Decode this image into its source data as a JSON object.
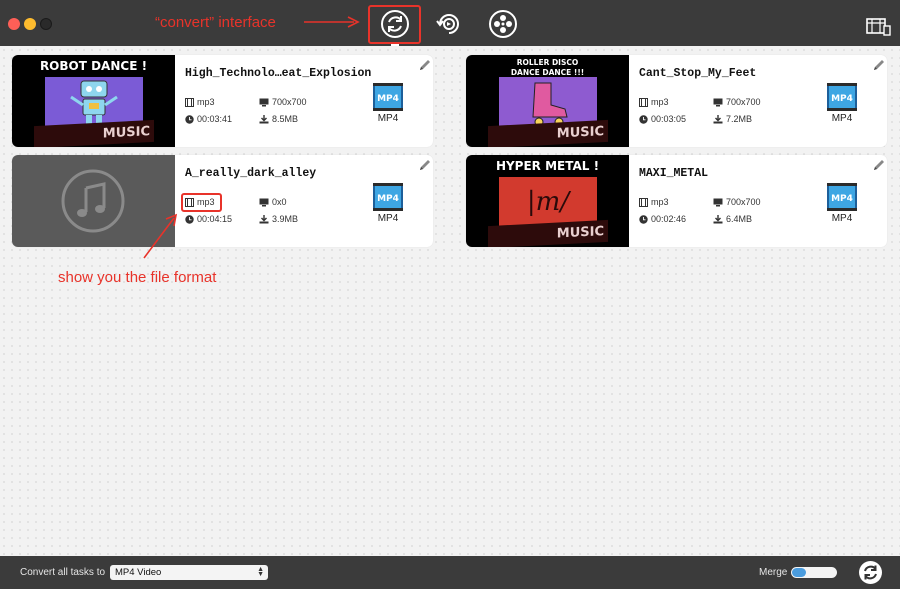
{
  "toolbar": {
    "active_tool": "convert",
    "tools": [
      "convert-icon",
      "rotate-convert-icon",
      "film-reel-icon"
    ],
    "settings_icon": "video-settings-icon"
  },
  "annotations": {
    "convert_note": "“convert” interface",
    "format_note": "show you the file format",
    "color": "#e8332a"
  },
  "tasks": [
    {
      "name": "High_Technolo…eat_Explosion",
      "thumb_title": "ROBOT DANCE !",
      "thumb_footer": "MUSIC",
      "format": "mp3",
      "resolution": "700x700",
      "duration": "00:03:41",
      "size": "8.5MB",
      "target": "MP4",
      "thumb_bg": "#7b5bd6"
    },
    {
      "name": "Cant_Stop_My_Feet",
      "thumb_title": "ROLLER DISCO\nDANCE DANCE !!!",
      "thumb_footer": "MUSIC",
      "format": "mp3",
      "resolution": "700x700",
      "duration": "00:03:05",
      "size": "7.2MB",
      "target": "MP4",
      "thumb_bg": "#8e5bd0"
    },
    {
      "name": "A_really_dark_alley",
      "thumb_title": "",
      "thumb_footer": "",
      "format": "mp3",
      "resolution": "0x0",
      "duration": "00:04:15",
      "size": "3.9MB",
      "target": "MP4",
      "thumb_bg": "#5a5a5a"
    },
    {
      "name": "MAXI_METAL",
      "thumb_title": "HYPER METAL !",
      "thumb_art_text": "|m/",
      "thumb_footer": "MUSIC",
      "format": "mp3",
      "resolution": "700x700",
      "duration": "00:02:46",
      "size": "6.4MB",
      "target": "MP4",
      "thumb_bg": "#d23a2e"
    }
  ],
  "bottom_bar": {
    "convert_all_label": "Convert all tasks to",
    "selected_format": "MP4 Video",
    "merge_label": "Merge"
  }
}
